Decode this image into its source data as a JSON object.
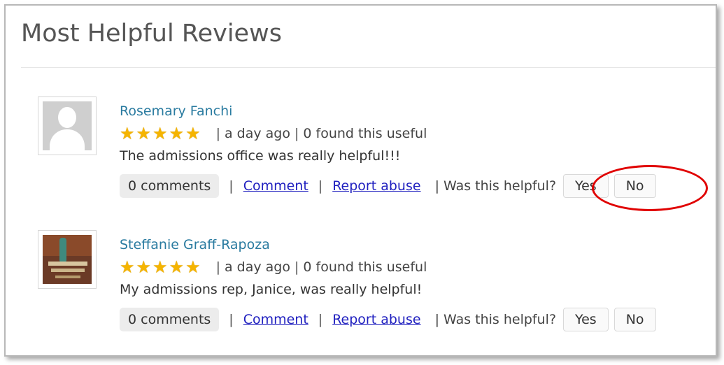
{
  "header": {
    "title": "Most Helpful Reviews"
  },
  "reviews": [
    {
      "avatar": "default-user-avatar",
      "name": "Rosemary Fanchi",
      "rating": 5,
      "stars": "★★★★★",
      "sep1": "|",
      "time": "a day ago",
      "sep2": "|",
      "useful": "0 found this useful",
      "text": "The admissions office was really helpful!!!",
      "comments": "0 comments",
      "pipe": "|",
      "comment_link": "Comment",
      "report_link": "Report abuse",
      "helpful_label": "| Was this helpful?",
      "yes": "Yes",
      "no": "No"
    },
    {
      "avatar": "book-cover-avatar",
      "name": "Steffanie Graff-Rapoza",
      "rating": 5,
      "stars": "★★★★★",
      "sep1": "|",
      "time": "a day ago",
      "sep2": "|",
      "useful": "0 found this useful",
      "text": "My admissions rep, Janice, was really helpful!",
      "comments": "0 comments",
      "pipe": "|",
      "comment_link": "Comment",
      "report_link": "Report abuse",
      "helpful_label": "| Was this helpful?",
      "yes": "Yes",
      "no": "No"
    }
  ],
  "colors": {
    "accent_name": "#2a7ba0",
    "link": "#1f1fbf",
    "star": "#f5b400",
    "highlight": "#e00000"
  }
}
